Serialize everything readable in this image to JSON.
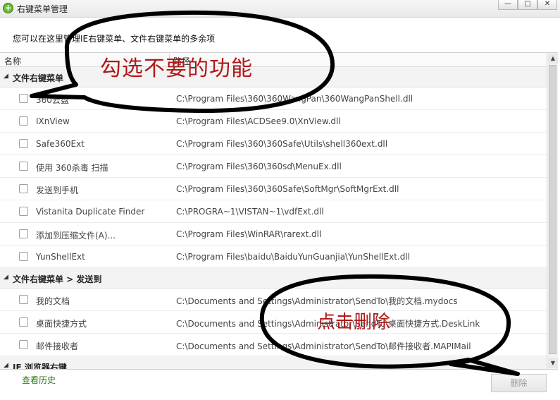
{
  "window": {
    "title": "右键菜单管理",
    "controls": [
      "—",
      "□",
      "✕"
    ]
  },
  "description": "您可以在这里管理IE右键菜单、文件右键菜单的多余项",
  "columns": {
    "name": "名称",
    "path": "路径"
  },
  "groups": [
    {
      "label": "文件右键菜单",
      "items": [
        {
          "name": "360云盘",
          "path": "C:\\Program Files\\360\\360WangPan\\360WangPanShell.dll"
        },
        {
          "name": "IXnView",
          "path": "C:\\Program Files\\ACDSee9.0\\XnView.dll"
        },
        {
          "name": "Safe360Ext",
          "path": "C:\\Program Files\\360\\360Safe\\Utils\\shell360ext.dll"
        },
        {
          "name": "使用 360杀毒 扫描",
          "path": "C:\\Program Files\\360\\360sd\\MenuEx.dll"
        },
        {
          "name": "发送到手机",
          "path": "C:\\Program Files\\360\\360Safe\\SoftMgr\\SoftMgrExt.dll"
        },
        {
          "name": "Vistanita Duplicate Finder",
          "path": "C:\\PROGRA~1\\VISTAN~1\\vdfExt.dll"
        },
        {
          "name": "添加到压缩文件(A)...",
          "path": "C:\\Program Files\\WinRAR\\rarext.dll"
        },
        {
          "name": "YunShellExt",
          "path": "C:\\Program Files\\baidu\\BaiduYunGuanjia\\YunShellExt.dll"
        }
      ]
    },
    {
      "label": "文件右键菜单 > 发送到",
      "items": [
        {
          "name": "我的文档",
          "path": "C:\\Documents and Settings\\Administrator\\SendTo\\我的文档.mydocs"
        },
        {
          "name": "桌面快捷方式",
          "path": "C:\\Documents and Settings\\Administrator\\SendTo\\桌面快捷方式.DeskLink"
        },
        {
          "name": "邮件接收者",
          "path": "C:\\Documents and Settings\\Administrator\\SendTo\\邮件接收者.MAPIMail"
        }
      ]
    },
    {
      "label": "IE 浏览器右键",
      "items": []
    }
  ],
  "footer": {
    "history_link": "查看历史",
    "delete_label": "删除"
  },
  "annotations": {
    "callout_top": "勾选不要的功能",
    "callout_bottom": "点击删除"
  }
}
